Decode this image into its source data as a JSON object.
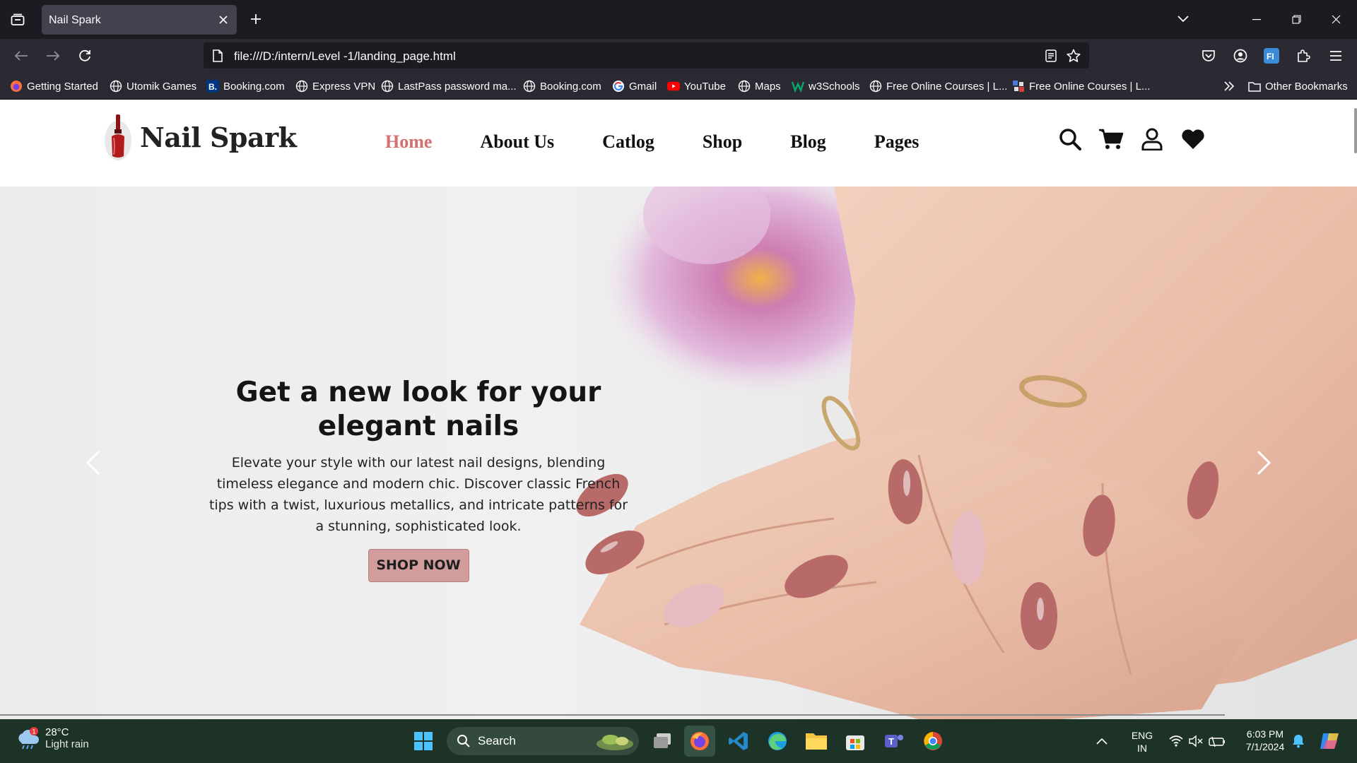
{
  "browser": {
    "tab": {
      "title": "Nail Spark"
    },
    "url": "file:///D:/intern/Level -1/landing_page.html",
    "bookmarks": [
      {
        "label": "Getting Started",
        "icon": "firefox-icon"
      },
      {
        "label": "Utomik Games",
        "icon": "globe-icon"
      },
      {
        "label": "Booking.com",
        "icon": "booking-icon"
      },
      {
        "label": "Express VPN",
        "icon": "globe-icon"
      },
      {
        "label": "LastPass password ma...",
        "icon": "globe-icon"
      },
      {
        "label": "Booking.com",
        "icon": "globe-icon"
      },
      {
        "label": "Gmail",
        "icon": "google-icon"
      },
      {
        "label": "YouTube",
        "icon": "youtube-icon"
      },
      {
        "label": "Maps",
        "icon": "globe-icon"
      },
      {
        "label": "w3Schools",
        "icon": "w3schools-icon"
      },
      {
        "label": "Free Online Courses | L...",
        "icon": "globe-icon"
      },
      {
        "label": "Free Online Courses | L...",
        "icon": "course-icon"
      }
    ],
    "other_bookmarks": "Other Bookmarks"
  },
  "site": {
    "logo_text": "Nail Spark",
    "menu": [
      {
        "label": "Home",
        "active": true
      },
      {
        "label": "About Us",
        "active": false
      },
      {
        "label": "Catlog",
        "active": false
      },
      {
        "label": "Shop",
        "active": false
      },
      {
        "label": "Blog",
        "active": false
      },
      {
        "label": "Pages",
        "active": false
      }
    ],
    "accent_color": "#d4706f",
    "hero": {
      "title": "Get a new look for your elegant nails",
      "text": "Elevate your style with our latest nail designs, blending timeless elegance and modern chic. Discover classic French tips with a twist, luxurious metallics, and intricate patterns for a stunning, sophisticated look.",
      "button": "SHOP NOW",
      "button_color": "#d19c9c"
    }
  },
  "taskbar": {
    "weather": {
      "temp": "28°C",
      "desc": "Light rain",
      "badge": "1"
    },
    "search_label": "Search",
    "lang": {
      "line1": "ENG",
      "line2": "IN"
    },
    "time": "6:03 PM",
    "date": "7/1/2024"
  }
}
